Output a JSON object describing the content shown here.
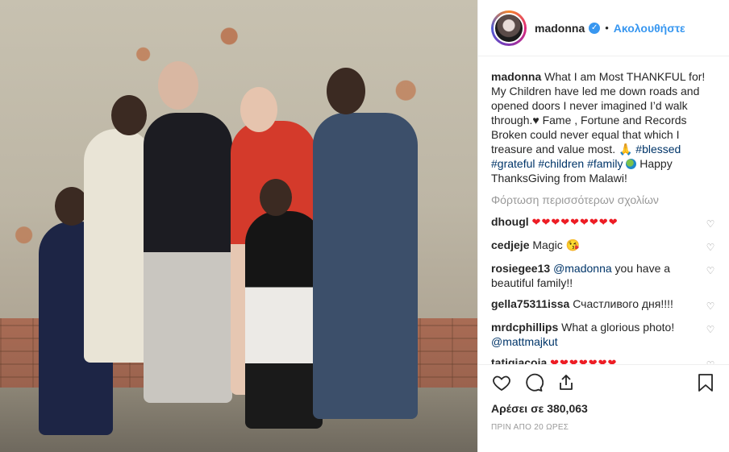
{
  "post": {
    "username": "madonna",
    "follow_label": "Ακολουθήστε",
    "caption_user": "madonna",
    "caption_text": "What I am Most THANKFUL for! My Children have led me down roads and opened doors I never imagined I’d walk through.♥ Fame , Fortune and Records Broken could never equal that which I treasure and value most. 🙏",
    "hashtags": [
      "#blessed",
      "#grateful",
      "#children",
      "#family"
    ],
    "caption_tail": "Happy ThanksGiving from Malawi!",
    "load_more": "Φόρτωση περισσότερων σχολίων",
    "likes": "Αρέσει σε 380,063",
    "time_ago": "ΠΡΙΝ ΑΠΟ 20 ΩΡΕΣ"
  },
  "comments": [
    {
      "user": "dhougl",
      "text": "❤❤❤❤❤❤❤❤❤"
    },
    {
      "user": "cedjeje",
      "text": "Magic 😘"
    },
    {
      "user": "rosiegee13",
      "mention": "@madonna",
      "text": "you have a beautiful family!!"
    },
    {
      "user": "gella75311issa",
      "text": "Счастливого дня!!!!"
    },
    {
      "user": "mrdcphillips",
      "text": "What a glorious photo!",
      "mention2": "@mattmajkut"
    },
    {
      "user": "tatigiacoia",
      "text": "❤❤❤❤❤❤❤"
    }
  ],
  "colors": {
    "accent": "#3897f0",
    "hashtag": "#003569",
    "muted": "#999999"
  }
}
